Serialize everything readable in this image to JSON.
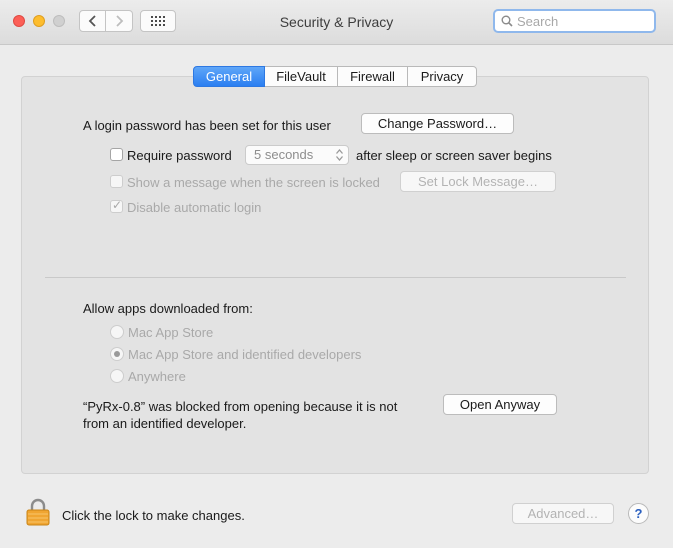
{
  "window": {
    "title": "Security & Privacy"
  },
  "toolbar": {
    "back_icon": "chevron-left-icon",
    "forward_icon": "chevron-right-icon",
    "show_all_icon": "grid-icon",
    "search_placeholder": "Search"
  },
  "tabs": [
    {
      "label": "General",
      "selected": true
    },
    {
      "label": "FileVault",
      "selected": false
    },
    {
      "label": "Firewall",
      "selected": false
    },
    {
      "label": "Privacy",
      "selected": false
    }
  ],
  "general": {
    "login_text": "A login password has been set for this user",
    "change_password_label": "Change Password…",
    "require_password_label": "Require password",
    "require_password_delay": "5 seconds",
    "require_password_suffix": "after sleep or screen saver begins",
    "show_message_label": "Show a message when the screen is locked",
    "set_lock_message_label": "Set Lock Message…",
    "disable_auto_login_label": "Disable automatic login",
    "check_mark": "✓"
  },
  "apps": {
    "heading": "Allow apps downloaded from:",
    "options": [
      {
        "label": "Mac App Store",
        "selected": false
      },
      {
        "label": "Mac App Store and identified developers",
        "selected": true
      },
      {
        "label": "Anywhere",
        "selected": false
      }
    ],
    "blocked_line1": "“PyRx-0.8” was blocked from opening because it is not",
    "blocked_line2": "from an identified developer.",
    "open_anyway_label": "Open Anyway"
  },
  "footer": {
    "lock_text": "Click the lock to make changes.",
    "advanced_label": "Advanced…",
    "help_label": "?"
  },
  "colors": {
    "accent": "#2b7ff1",
    "close": "#fc5f57",
    "minimize": "#fdbd2e",
    "lock": "#f0a531"
  }
}
